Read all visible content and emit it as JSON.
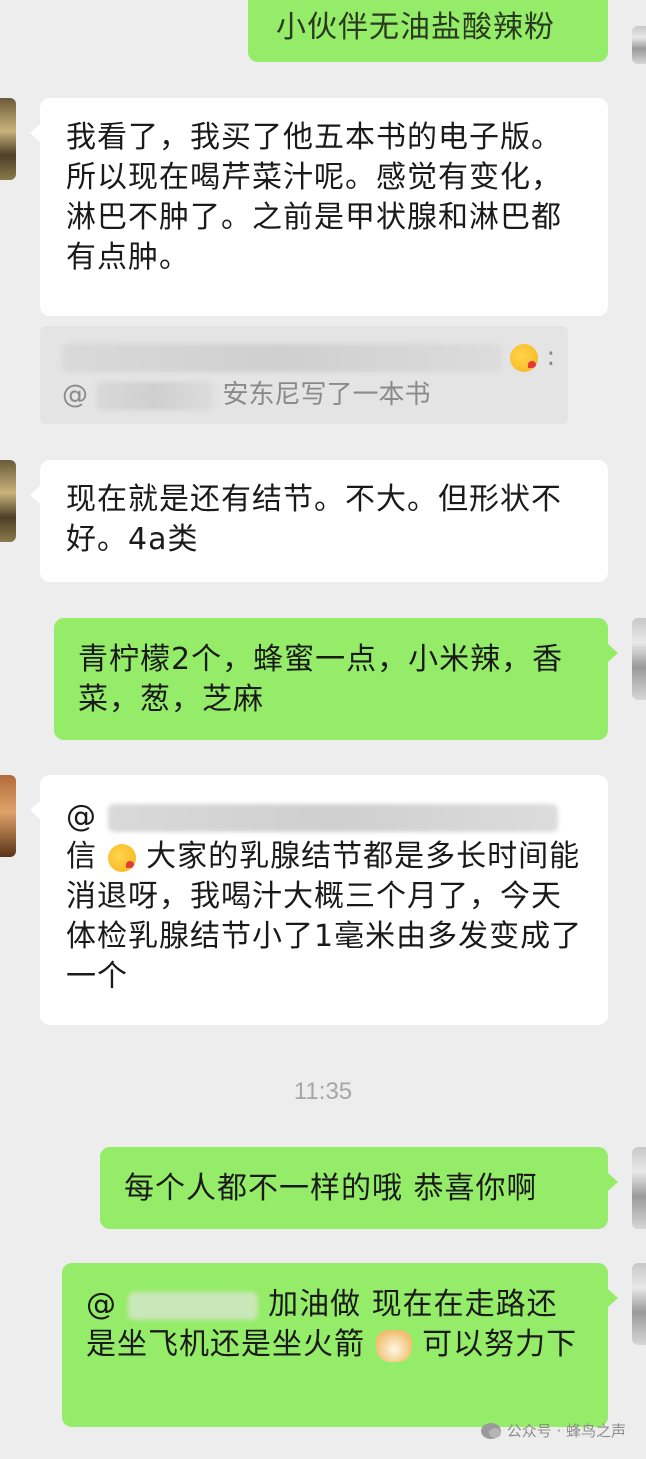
{
  "messages": {
    "m0_text": "小伙伴无油盐酸辣粉",
    "m1_text": "我看了，我买了他五本书的电子版。所以现在喝芹菜汁呢。感觉有变化，淋巴不肿了。之前是甲状腺和淋巴都有点肿。",
    "m1_quote_tail": ":",
    "m1_quote_at": "@",
    "m1_quote_text": "安东尼写了一本书",
    "m2_text": "现在就是还有结节。不大。但形状不好。4a类",
    "m3_text": "青柠檬2个，蜂蜜一点，小米辣，香菜，葱，芝麻",
    "m4_at": "@",
    "m4_prefix": "信",
    "m4_text": "大家的乳腺结节都是多长时间能消退呀，我喝汁大概三个月了，今天体检乳腺结节小了1毫米由多发变成了一个",
    "m5_text": "每个人都不一样的哦 恭喜你啊",
    "m6_at": "@",
    "m6_text_a": "加油做 现在在走路还是坐飞机还是坐火箭",
    "m6_text_b": "可以努力下"
  },
  "timestamp": "11:35",
  "watermark": {
    "text": "公众号 · 蜂鸟之声"
  },
  "icons": {
    "kiss_emoji": "face-blowing-kiss-icon",
    "doge_emoji": "doge-emoji-icon",
    "watermark_logo": "wechat-official-account-icon"
  },
  "colors": {
    "background": "#ededed",
    "incoming_bubble": "#ffffff",
    "outgoing_bubble": "#95ec69",
    "timestamp": "#a6a6a6"
  }
}
